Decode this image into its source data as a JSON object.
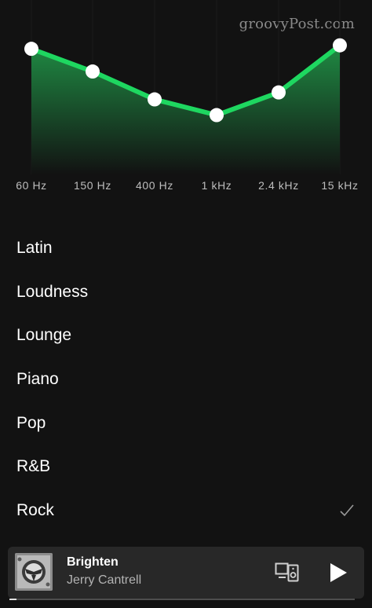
{
  "watermark": "groovyPost.com",
  "equalizer": {
    "bands": [
      "60 Hz",
      "150 Hz",
      "400 Hz",
      "1 kHz",
      "2.4 kHz",
      "15 kHz"
    ],
    "levels": [
      0.72,
      0.59,
      0.43,
      0.34,
      0.47,
      0.74
    ],
    "accent_color": "#1ed760"
  },
  "presets": [
    {
      "label": "Latin",
      "selected": false
    },
    {
      "label": "Loudness",
      "selected": false
    },
    {
      "label": "Lounge",
      "selected": false
    },
    {
      "label": "Piano",
      "selected": false
    },
    {
      "label": "Pop",
      "selected": false
    },
    {
      "label": "R&B",
      "selected": false
    },
    {
      "label": "Rock",
      "selected": true
    }
  ],
  "now_playing": {
    "title": "Brighten",
    "artist": "Jerry Cantrell",
    "progress": 0.02,
    "devices_icon": "devices-icon",
    "play_icon": "play-icon"
  }
}
